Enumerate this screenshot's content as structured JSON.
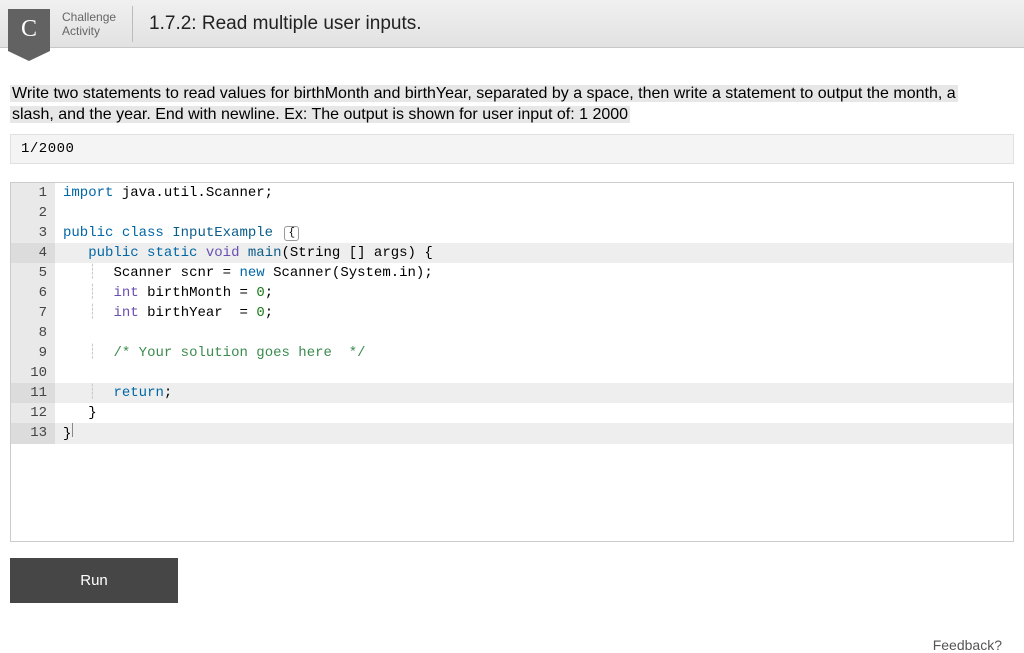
{
  "header": {
    "badge_letter": "C",
    "label_line1": "Challenge",
    "label_line2": "Activity",
    "title": "1.7.2: Read multiple user inputs."
  },
  "prompt": {
    "full_text": "Write two statements to read values for birthMonth and birthYear, separated by a space, then write a statement to output the month, a slash, and the year. End with newline. Ex: The output is shown for user input of: 1 2000"
  },
  "output_sample": "1/2000",
  "code": {
    "lines": [
      {
        "n": 1,
        "hl": false
      },
      {
        "n": 2,
        "hl": false
      },
      {
        "n": 3,
        "hl": false
      },
      {
        "n": 4,
        "hl": true
      },
      {
        "n": 5,
        "hl": false
      },
      {
        "n": 6,
        "hl": false
      },
      {
        "n": 7,
        "hl": false
      },
      {
        "n": 8,
        "hl": false
      },
      {
        "n": 9,
        "hl": false
      },
      {
        "n": 10,
        "hl": false
      },
      {
        "n": 11,
        "hl": true
      },
      {
        "n": 12,
        "hl": false
      },
      {
        "n": 13,
        "hl": true
      }
    ],
    "source": "import java.util.Scanner;\n\npublic class InputExample {\n   public static void main(String [] args) {\n      Scanner scnr = new Scanner(System.in);\n      int birthMonth = 0;\n      int birthYear  = 0;\n\n      /* Your solution goes here  */\n\n      return;\n   }\n}"
  },
  "run_label": "Run",
  "feedback_label": "Feedback?"
}
